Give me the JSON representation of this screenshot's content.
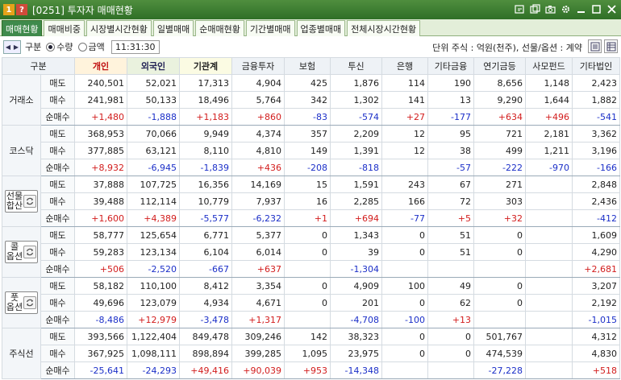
{
  "window": {
    "badge1": "1",
    "badge2": "?",
    "title": "[0251] 투자자 매매현황",
    "icons": [
      "link-icon",
      "copy-icon",
      "camera-icon",
      "gear-icon",
      "minimize-icon",
      "maximize-icon",
      "close-icon"
    ]
  },
  "tabs": [
    {
      "label": "매매현황",
      "active": true
    },
    {
      "label": "매매비중"
    },
    {
      "label": "시장별시간현황"
    },
    {
      "label": "일별매매"
    },
    {
      "label": "순매매현황"
    },
    {
      "label": "기간별매매"
    },
    {
      "label": "업종별매매"
    },
    {
      "label": "전체시장시간현황"
    }
  ],
  "toolbar": {
    "gubun_label": "구분",
    "radio_qty": "수량",
    "radio_amt": "금액",
    "time": "11:31:30",
    "unit_text": "단위 주식 : 억원(천주), 선물/옵션 : 계약"
  },
  "headers": [
    "구분",
    "개인",
    "외국인",
    "기관계",
    "금융투자",
    "보험",
    "투신",
    "은행",
    "기타금융",
    "연기금등",
    "사모펀드",
    "기타법인"
  ],
  "groups": [
    {
      "name": "거래소",
      "lines": [
        "거래소"
      ],
      "cycle": false,
      "rows": [
        {
          "label": "매도",
          "cells": [
            "240,501",
            "52,021",
            "17,313",
            "4,904",
            "425",
            "1,876",
            "114",
            "190",
            "8,656",
            "1,148",
            "2,423"
          ]
        },
        {
          "label": "매수",
          "cells": [
            "241,981",
            "50,133",
            "18,496",
            "5,764",
            "342",
            "1,302",
            "141",
            "13",
            "9,290",
            "1,644",
            "1,882"
          ]
        },
        {
          "label": "순매수",
          "cells": [
            "+1,480",
            "-1,888",
            "+1,183",
            "+860",
            "-83",
            "-574",
            "+27",
            "-177",
            "+634",
            "+496",
            "-541"
          ]
        }
      ]
    },
    {
      "name": "코스닥",
      "lines": [
        "코스닥"
      ],
      "cycle": false,
      "rows": [
        {
          "label": "매도",
          "cells": [
            "368,953",
            "70,066",
            "9,949",
            "4,374",
            "357",
            "2,209",
            "12",
            "95",
            "721",
            "2,181",
            "3,362"
          ]
        },
        {
          "label": "매수",
          "cells": [
            "377,885",
            "63,121",
            "8,110",
            "4,810",
            "149",
            "1,391",
            "12",
            "38",
            "499",
            "1,211",
            "3,196"
          ]
        },
        {
          "label": "순매수",
          "cells": [
            "+8,932",
            "-6,945",
            "-1,839",
            "+436",
            "-208",
            "-818",
            "",
            "-57",
            "-222",
            "-970",
            "-166"
          ]
        }
      ]
    },
    {
      "name": "선물합산",
      "lines": [
        "선물",
        "합산"
      ],
      "cycle": true,
      "rows": [
        {
          "label": "매도",
          "cells": [
            "37,888",
            "107,725",
            "16,356",
            "14,169",
            "15",
            "1,591",
            "243",
            "67",
            "271",
            "",
            "2,848"
          ]
        },
        {
          "label": "매수",
          "cells": [
            "39,488",
            "112,114",
            "10,779",
            "7,937",
            "16",
            "2,285",
            "166",
            "72",
            "303",
            "",
            "2,436"
          ]
        },
        {
          "label": "순매수",
          "cells": [
            "+1,600",
            "+4,389",
            "-5,577",
            "-6,232",
            "+1",
            "+694",
            "-77",
            "+5",
            "+32",
            "",
            "-412"
          ]
        }
      ]
    },
    {
      "name": "콜옵션",
      "lines": [
        "콜",
        "옵션"
      ],
      "cycle": true,
      "rows": [
        {
          "label": "매도",
          "cells": [
            "58,777",
            "125,654",
            "6,771",
            "5,377",
            "0",
            "1,343",
            "0",
            "51",
            "0",
            "",
            "1,609"
          ]
        },
        {
          "label": "매수",
          "cells": [
            "59,283",
            "123,134",
            "6,104",
            "6,014",
            "0",
            "39",
            "0",
            "51",
            "0",
            "",
            "4,290"
          ]
        },
        {
          "label": "순매수",
          "cells": [
            "+506",
            "-2,520",
            "-667",
            "+637",
            "",
            "-1,304",
            "",
            "",
            "",
            "",
            "+2,681"
          ]
        }
      ]
    },
    {
      "name": "풋옵션",
      "lines": [
        "풋",
        "옵션"
      ],
      "cycle": true,
      "rows": [
        {
          "label": "매도",
          "cells": [
            "58,182",
            "110,100",
            "8,412",
            "3,354",
            "0",
            "4,909",
            "100",
            "49",
            "0",
            "",
            "3,207"
          ]
        },
        {
          "label": "매수",
          "cells": [
            "49,696",
            "123,079",
            "4,934",
            "4,671",
            "0",
            "201",
            "0",
            "62",
            "0",
            "",
            "2,192"
          ]
        },
        {
          "label": "순매수",
          "cells": [
            "-8,486",
            "+12,979",
            "-3,478",
            "+1,317",
            "",
            "-4,708",
            "-100",
            "+13",
            "",
            "",
            "-1,015"
          ]
        }
      ]
    },
    {
      "name": "주식선",
      "lines": [
        "주식선"
      ],
      "cycle": false,
      "rows": [
        {
          "label": "매도",
          "cells": [
            "393,566",
            "1,122,404",
            "849,478",
            "309,246",
            "142",
            "38,323",
            "0",
            "0",
            "501,767",
            "",
            "4,312"
          ]
        },
        {
          "label": "매수",
          "cells": [
            "367,925",
            "1,098,111",
            "898,894",
            "399,285",
            "1,095",
            "23,975",
            "0",
            "0",
            "474,539",
            "",
            "4,830"
          ]
        },
        {
          "label": "순매수",
          "cells": [
            "-25,641",
            "-24,293",
            "+49,416",
            "+90,039",
            "+953",
            "-14,348",
            "",
            "",
            "-27,228",
            "",
            "+518"
          ]
        }
      ]
    }
  ],
  "colors": {
    "positive": "#d21c1c",
    "negative": "#1b2fc8",
    "title_bar": "#3a7a30",
    "active_tab": "#3f8a4c"
  }
}
